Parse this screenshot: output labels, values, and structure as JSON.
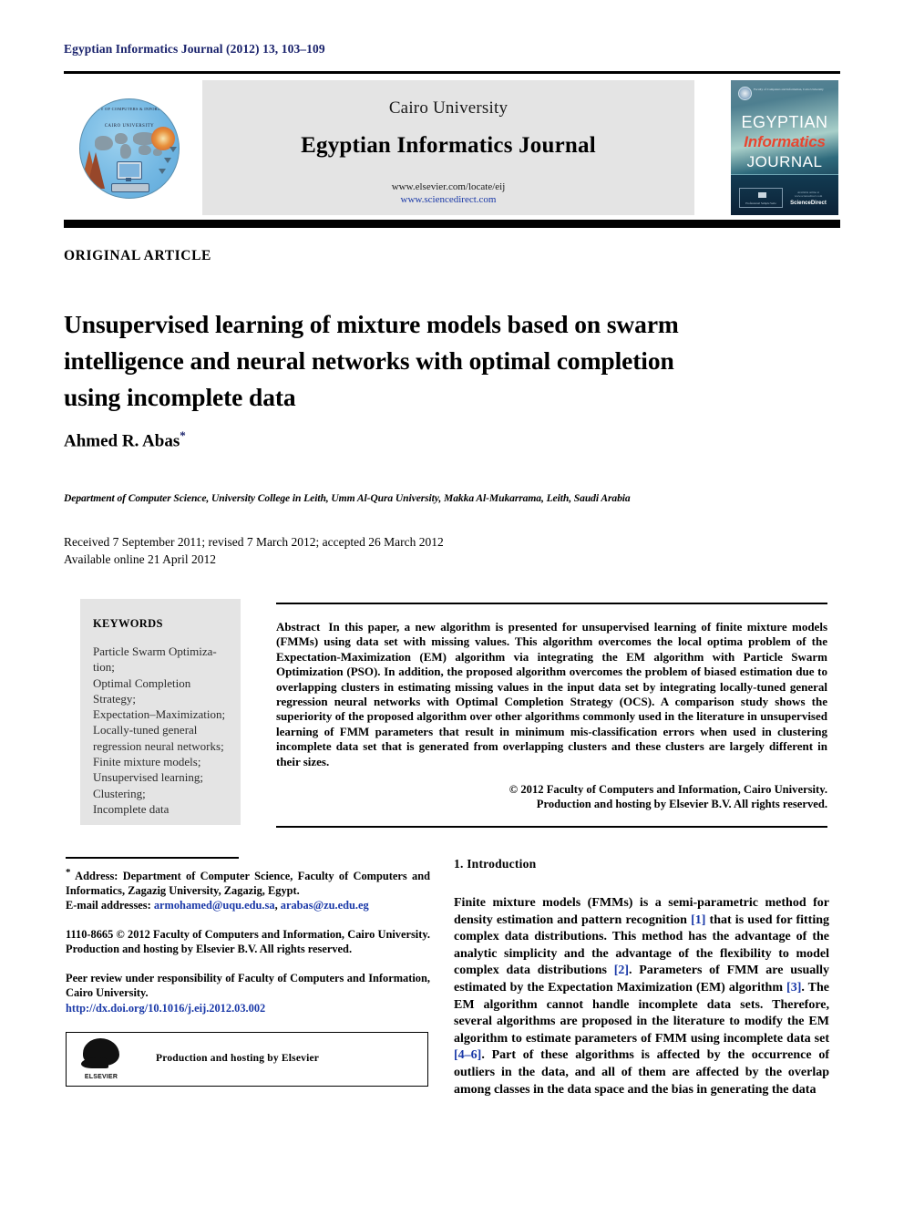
{
  "running_head": "Egyptian Informatics Journal (2012) 13, 103–109",
  "masthead": {
    "university": "Cairo University",
    "journal_title": "Egyptian Informatics Journal",
    "url_elsevier": "www.elsevier.com/locate/eij",
    "url_sciencedirect": "www.sciencedirect.com",
    "logo_left": {
      "arc_text": "FACULTY OF COMPUTERS & INFORMATION",
      "institution": "CAIRO UNIVERSITY"
    },
    "cover": {
      "line1": "EGYPTIAN",
      "line2": "Informatics",
      "line3": "JOURNAL",
      "seal_text": "Faculty of Computers and Information, Cairo University",
      "box_caption": "Professional Sample Serie",
      "sd_small": "Available online at www.sciencedirect.com",
      "sd_brand": "ScienceDirect",
      "accent_red": "#e8452f",
      "accent_teal": "#4e7f90"
    }
  },
  "article": {
    "kicker": "ORIGINAL ARTICLE",
    "title": "Unsupervised learning of mixture models based on swarm intelligence and neural networks with optimal completion using incomplete data",
    "author": "Ahmed R. Abas",
    "author_marker": "*",
    "affiliation": "Department of Computer Science, University College in Leith, Umm Al-Qura University, Makka Al-Mukarrama, Leith, Saudi Arabia",
    "received_line": "Received 7 September 2011; revised 7 March 2012; accepted 26 March 2012",
    "available_line": "Available online 21 April 2012"
  },
  "keywords": {
    "heading": "KEYWORDS",
    "items": [
      "Particle Swarm Optimiza-\ntion;",
      "Optimal Completion\nStrategy;",
      "Expectation–Maximization;",
      "Locally-tuned general\nregression neural networks;",
      "Finite mixture models;",
      "Unsupervised learning;",
      "Clustering;",
      "Incomplete data"
    ]
  },
  "abstract": {
    "label": "Abstract",
    "text": "In this paper, a new algorithm is presented for unsupervised learning of finite mixture models (FMMs) using data set with missing values. This algorithm overcomes the local optima problem of the Expectation-Maximization (EM) algorithm via integrating the EM algorithm with Particle Swarm Optimization (PSO). In addition, the proposed algorithm overcomes the problem of biased estimation due to overlapping clusters in estimating missing values in the input data set by integrating locally-tuned general regression neural networks with Optimal Completion Strategy (OCS). A comparison study shows the superiority of the proposed algorithm over other algorithms commonly used in the literature in unsupervised learning of FMM parameters that result in minimum mis-classification errors when used in clustering incomplete data set that is generated from overlapping clusters and these clusters are largely different in their sizes.",
    "copyright_line1": "© 2012 Faculty of Computers and Information, Cairo University.",
    "copyright_line2": "Production and hosting by Elsevier B.V. All rights reserved."
  },
  "footnotes": {
    "address_marker": "*",
    "address": "Address: Department of Computer Science, Faculty of Computers and Informatics, Zagazig University, Zagazig, Egypt.",
    "email_label": "E-mail addresses:",
    "email1": "armohamed@uqu.edu.sa",
    "email_sep": ", ",
    "email2": "arabas@zu.edu.eg",
    "issn_block": "1110-8665 © 2012 Faculty of Computers and Information, Cairo University. Production and hosting by Elsevier B.V. All rights reserved.",
    "peer_review": "Peer review under responsibility of Faculty of Computers and Information, Cairo University.",
    "doi": "http://dx.doi.org/10.1016/j.eij.2012.03.002",
    "elsevier_box_text": "Production and hosting by Elsevier",
    "elsevier_logo_name": "ELSEVIER"
  },
  "introduction": {
    "heading": "1. Introduction",
    "para_part1": "Finite mixture models (FMMs) is a semi-parametric method for density estimation and pattern recognition ",
    "cite1": "[1]",
    "para_part2": " that is used for fitting complex data distributions. This method has the advantage of the analytic simplicity and the advantage of the flexibility to model complex data distributions ",
    "cite2": "[2]",
    "para_part3": ". Parameters of FMM are usually estimated by the Expectation Maximization (EM) algorithm ",
    "cite3": "[3]",
    "para_part4": ". The EM algorithm cannot handle incomplete data sets. Therefore, several algorithms are proposed in the literature to modify the EM algorithm to estimate parameters of FMM using incomplete data set ",
    "cite4": "[4–6]",
    "para_part5": ". Part of these algorithms is affected by the occurrence of outliers in the data, and all of them are affected by the overlap among classes in the data space and the bias in generating the data"
  }
}
